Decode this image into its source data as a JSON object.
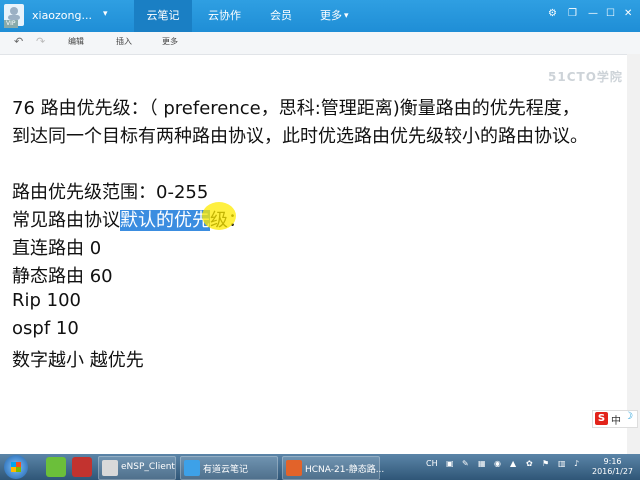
{
  "titlebar": {
    "vip": "VIP",
    "username": "xiaozong...",
    "nav": [
      "云笔记",
      "云协作",
      "会员",
      "更多"
    ]
  },
  "toolbar": {
    "edit": "编辑",
    "insert": "插入",
    "more": "更多"
  },
  "watermark": "51CTO学院",
  "content": {
    "line1": "76   路由优先级：（ preference，思科:管理距离)衡量路由的优先程度，",
    "line2": "到达同一个目标有两种路由协议，此时优选路由优先级较小的路由协议。",
    "line3": "路由优先级范围：0-255",
    "line4_pre": "常见路由协议",
    "line4_hl": "默认的优先",
    "line4_post": "级：",
    "line5": "直连路由  0",
    "line6": "静态路由 60",
    "line7": "Rip  100",
    "line8": "ospf  10",
    "line9": "数字越小 越优先"
  },
  "ime": {
    "logo": "S",
    "lang": "中",
    "mode": "☽"
  },
  "taskbar": {
    "tasks": [
      "eNSP_Client",
      "有道云笔记",
      "HCNA-21-静态路..."
    ],
    "tray_lang": "CH",
    "time": "9:16",
    "date": "2016/1/27"
  },
  "icons": [
    "user-icon",
    "search-icon",
    "back-arrow-icon",
    "forward-arrow-icon",
    "settings-icon",
    "minimize-icon",
    "maximize-icon",
    "close-icon"
  ],
  "colors": {
    "titlebar": "#1f8ed6",
    "highlight": "#3b8de0",
    "cursor": "#ffeb00"
  }
}
